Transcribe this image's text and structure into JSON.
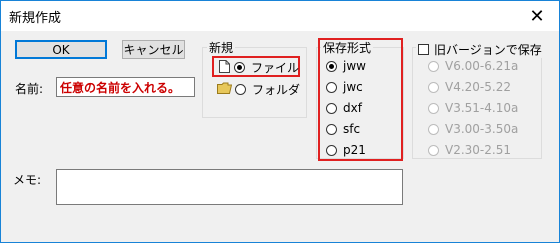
{
  "window": {
    "title": "新規作成",
    "close_glyph": "✕"
  },
  "buttons": {
    "ok": "OK",
    "cancel": "キャンセル"
  },
  "name": {
    "label": "名前:",
    "value": "任意の名前を入れる。"
  },
  "memo": {
    "label": "メモ:",
    "value": ""
  },
  "new_group": {
    "title": "新規",
    "options": [
      {
        "label": "ファイル",
        "icon": "file-icon",
        "checked": true
      },
      {
        "label": "フォルダ",
        "icon": "folder-icon",
        "checked": false
      }
    ]
  },
  "format_group": {
    "title": "保存形式",
    "options": [
      {
        "label": "jww",
        "checked": true
      },
      {
        "label": "jwc",
        "checked": false
      },
      {
        "label": "dxf",
        "checked": false
      },
      {
        "label": "sfc",
        "checked": false
      },
      {
        "label": "p21",
        "checked": false
      }
    ]
  },
  "old_version_group": {
    "title": "旧バージョンで保存",
    "checked": false,
    "options": [
      {
        "label": "V6.00-6.21a",
        "enabled": false
      },
      {
        "label": "V4.20-5.22",
        "enabled": false
      },
      {
        "label": "V3.51-4.10a",
        "enabled": false
      },
      {
        "label": "V3.00-3.50a",
        "enabled": false
      },
      {
        "label": "V2.30-2.51",
        "enabled": false
      }
    ]
  },
  "colors": {
    "highlight_box": "#e02020",
    "name_text": "#cc0000",
    "title_border": "#1883d7"
  }
}
